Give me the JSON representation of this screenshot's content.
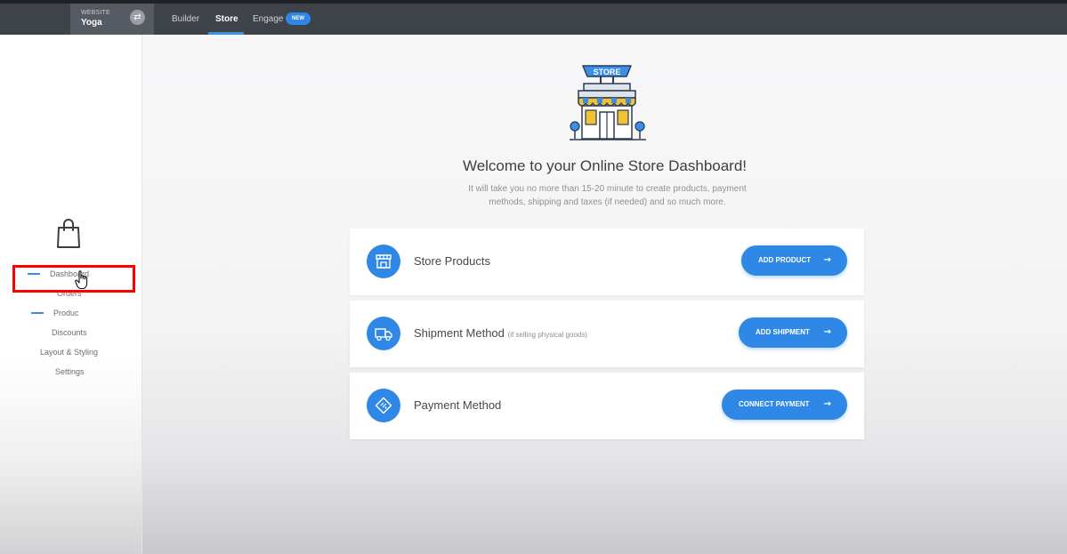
{
  "topbar": {
    "site_kicker": "WEBSITE",
    "site_name": "Yoga",
    "tabs": [
      {
        "label": "Builder"
      },
      {
        "label": "Store"
      },
      {
        "label": "Engage"
      }
    ],
    "new_badge": "NEW"
  },
  "sidebar": {
    "items": [
      {
        "label": "Dashboard"
      },
      {
        "label": "Orders"
      },
      {
        "label": "Produc"
      },
      {
        "label": "Discounts"
      },
      {
        "label": "Layout & Styling"
      },
      {
        "label": "Settings"
      }
    ]
  },
  "main": {
    "illustration_sign": "STORE",
    "welcome_title": "Welcome to your Online Store Dashboard!",
    "subtitle_line1": "It will take you no more than 15-20 minute to create products, payment",
    "subtitle_line2": "methods, shipping and taxes (if needed) and so much more.",
    "cards": [
      {
        "title": "Store Products",
        "note": "",
        "button": "ADD PRODUCT",
        "icon": "storefront-icon"
      },
      {
        "title": "Shipment Method",
        "note": "(if selling physical goods)",
        "button": "ADD SHIPMENT",
        "icon": "truck-icon"
      },
      {
        "title": "Payment Method",
        "note": "",
        "button": "CONNECT PAYMENT",
        "icon": "ticket-icon"
      }
    ],
    "arrow": "→"
  },
  "colors": {
    "accent": "#2f88e6",
    "topbar": "#3e4249",
    "highlight_box": "#ff0000"
  }
}
